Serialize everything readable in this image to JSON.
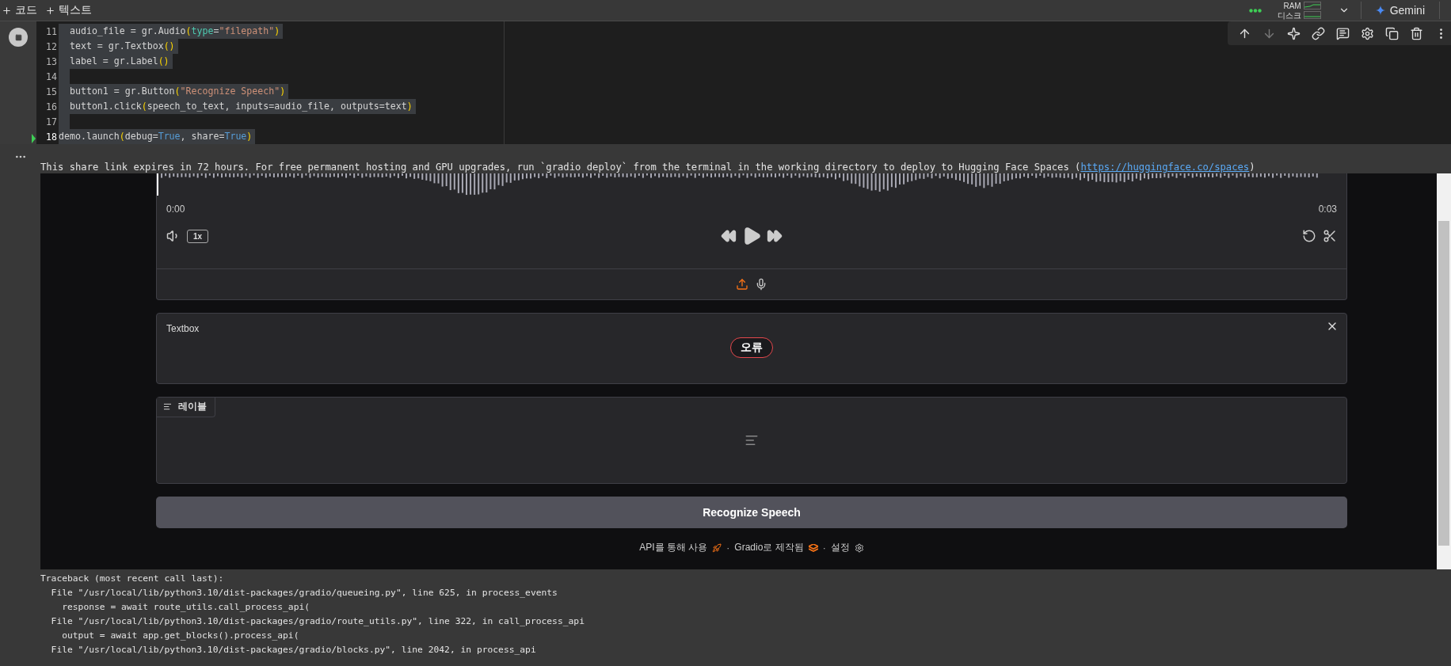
{
  "topbar": {
    "add_buttons": [
      {
        "label": "코드"
      },
      {
        "label": "텍스트"
      }
    ],
    "resources": {
      "ram_label": "RAM",
      "disk_label": "디스크"
    },
    "gemini": "Gemini"
  },
  "cell": {
    "code_lines": [
      {
        "number": "11",
        "selected": true,
        "current": false,
        "tokens": [
          {
            "kind": "plain",
            "text": "  audio_file = gr.Audio"
          },
          {
            "kind": "paren",
            "text": "("
          },
          {
            "kind": "param",
            "text": "type"
          },
          {
            "kind": "plain",
            "text": "="
          },
          {
            "kind": "string",
            "text": "\"filepath\""
          },
          {
            "kind": "paren",
            "text": ")"
          }
        ]
      },
      {
        "number": "12",
        "selected": true,
        "current": false,
        "tokens": [
          {
            "kind": "plain",
            "text": "  text = gr.Textbox"
          },
          {
            "kind": "paren",
            "text": "()"
          }
        ]
      },
      {
        "number": "13",
        "selected": true,
        "current": false,
        "tokens": [
          {
            "kind": "plain",
            "text": "  label = gr.Label"
          },
          {
            "kind": "paren",
            "text": "()"
          }
        ]
      },
      {
        "number": "14",
        "selected": true,
        "current": false
      },
      {
        "number": "15",
        "selected": true,
        "current": false,
        "tokens": [
          {
            "kind": "plain",
            "text": "  button1 = gr.Button"
          },
          {
            "kind": "paren",
            "text": "("
          },
          {
            "kind": "string",
            "text": "\"Recognize Speech\""
          },
          {
            "kind": "paren",
            "text": ")"
          }
        ]
      },
      {
        "number": "16",
        "selected": true,
        "current": false,
        "tokens": [
          {
            "kind": "plain",
            "text": "  button1.click"
          },
          {
            "kind": "paren",
            "text": "("
          },
          {
            "kind": "plain",
            "text": "speech_to_text, inputs=audio_file, outputs=text"
          },
          {
            "kind": "paren",
            "text": ")"
          }
        ]
      },
      {
        "number": "17",
        "selected": true,
        "current": false
      },
      {
        "number": "18",
        "selected": true,
        "current": true,
        "tokens": [
          {
            "kind": "plain",
            "text": "demo.launch"
          },
          {
            "kind": "paren",
            "text": "("
          },
          {
            "kind": "plain",
            "text": "debug="
          },
          {
            "kind": "keyword",
            "text": "True"
          },
          {
            "kind": "plain",
            "text": ", share="
          },
          {
            "kind": "keyword",
            "text": "True"
          },
          {
            "kind": "paren",
            "text": ")"
          }
        ]
      }
    ],
    "toolbar": [
      {
        "kind": "up",
        "disabled": false
      },
      {
        "kind": "down",
        "disabled": true
      },
      {
        "kind": "sparkle",
        "disabled": false
      },
      {
        "kind": "link",
        "disabled": false
      },
      {
        "kind": "comment",
        "disabled": false
      },
      {
        "kind": "gear",
        "disabled": false
      },
      {
        "kind": "mirror",
        "disabled": false
      },
      {
        "kind": "trash",
        "disabled": false
      },
      {
        "kind": "more",
        "disabled": false
      }
    ]
  },
  "output": {
    "share_notice": {
      "text": "This share link expires in 72 hours. For free permanent hosting and GPU upgrades, run `gradio deploy` from the terminal in the working directory to deploy to Hugging Face Spaces (",
      "link": "https://huggingface.co/spaces",
      "after": ")"
    },
    "app": {
      "audio": {
        "start_time": "0:00",
        "end_time": "0:03",
        "speed": "1x"
      },
      "textbox": {
        "label": "Textbox",
        "status": "오류"
      },
      "label": {
        "label": "레이블"
      },
      "submit_button": "Recognize Speech",
      "footer": [
        {
          "kind": "api",
          "text": "API를 통해 사용"
        },
        {
          "kind": "gradio",
          "prefix": "·",
          "text": "Gradio로 제작됨"
        },
        {
          "kind": "settings",
          "prefix": "·",
          "text": "설정"
        }
      ]
    },
    "traceback": [
      "Traceback (most recent call last):",
      "  File \"/usr/local/lib/python3.10/dist-packages/gradio/queueing.py\", line 625, in process_events",
      "    response = await route_utils.call_process_api(",
      "  File \"/usr/local/lib/python3.10/dist-packages/gradio/route_utils.py\", line 322, in call_process_api",
      "    output = await app.get_blocks().process_api(",
      "  File \"/usr/local/lib/python3.10/dist-packages/gradio/blocks.py\", line 2042, in process_api"
    ]
  }
}
